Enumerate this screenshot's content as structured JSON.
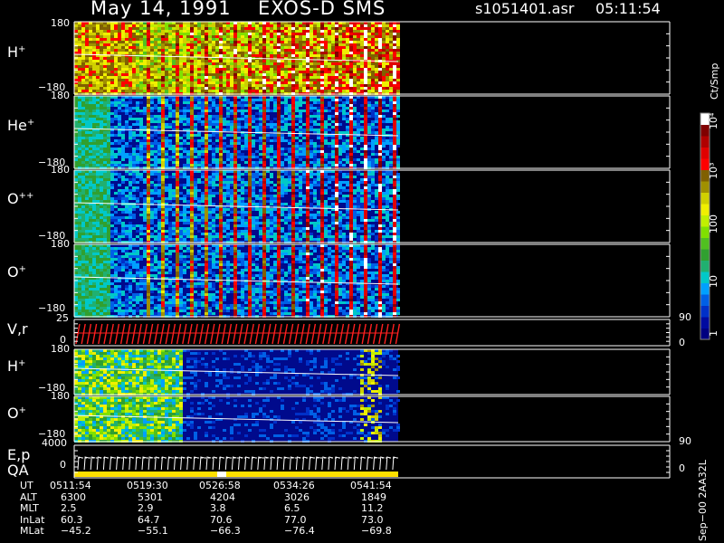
{
  "header": {
    "date": "May 14, 1991",
    "instrument": "EXOS-D SMS",
    "file": "s1051401.asr",
    "time": "05:11:54"
  },
  "colorbar": {
    "units": "Ct/Smp",
    "ticks": [
      "1",
      "10",
      "100",
      "10³",
      "10⁴"
    ],
    "colors": [
      "#000080",
      "#000aa0",
      "#0030c8",
      "#0060e6",
      "#00a0ff",
      "#00c8c8",
      "#20b070",
      "#30a030",
      "#50c020",
      "#80e000",
      "#c0f000",
      "#f0f000",
      "#d0d000",
      "#a09000",
      "#806000",
      "#ff0000",
      "#e00000",
      "#b00000",
      "#800000",
      "#ffffff"
    ]
  },
  "panels": [
    {
      "label": "H",
      "charge": "+",
      "top": "180",
      "bottom": "−180"
    },
    {
      "label": "He",
      "charge": "+",
      "top": "180",
      "bottom": "−180"
    },
    {
      "label": "O",
      "charge": "++",
      "top": "180",
      "bottom": "−180"
    },
    {
      "label": "O",
      "charge": "+",
      "top": "180",
      "bottom": "−180"
    },
    {
      "label": "V,r",
      "charge": "",
      "top": "25",
      "bottom": "0",
      "right_top": "90",
      "right_bottom": "0"
    },
    {
      "label": "H",
      "charge": "+",
      "top": "180",
      "bottom": "−180"
    },
    {
      "label": "O",
      "charge": "+",
      "top": "180",
      "bottom": "−180"
    },
    {
      "label": "E,p",
      "label2": "QA",
      "charge": "",
      "top": "4000",
      "bottom": "0",
      "right_top": "90",
      "right_bottom": "0"
    }
  ],
  "ephemeris": {
    "rows": [
      {
        "name": "UT",
        "values": [
          "0511:54",
          "0519:30",
          "0526:58",
          "0534:26",
          "0541:54"
        ]
      },
      {
        "name": "ALT",
        "values": [
          "6300",
          "5301",
          "4204",
          "3026",
          "1849"
        ]
      },
      {
        "name": "MLT",
        "values": [
          "2.5",
          "2.9",
          "3.8",
          "6.5",
          "11.2"
        ]
      },
      {
        "name": "InLat",
        "values": [
          "60.3",
          "64.7",
          "70.6",
          "77.0",
          "73.0"
        ]
      },
      {
        "name": "MLat",
        "values": [
          "−45.2",
          "−55.1",
          "−66.3",
          "−76.4",
          "−69.8"
        ]
      }
    ]
  },
  "footer_id": "Sep−00  2AA32L",
  "chart_data": {
    "type": "heatmap",
    "title": "May 14, 1991   EXOS-D SMS",
    "xlabel": "UT",
    "x": [
      "0511:54",
      "0519:30",
      "0526:58",
      "0534:26",
      "0541:54"
    ],
    "ylim": [
      -180,
      180
    ],
    "series": [
      {
        "name": "H+",
        "ylim": [
          -180,
          180
        ]
      },
      {
        "name": "He+",
        "ylim": [
          -180,
          180
        ]
      },
      {
        "name": "O++",
        "ylim": [
          -180,
          180
        ]
      },
      {
        "name": "O+",
        "ylim": [
          -180,
          180
        ]
      },
      {
        "name": "V,r",
        "ylim": [
          0,
          25
        ],
        "right_ylim": [
          0,
          90
        ]
      },
      {
        "name": "H+",
        "ylim": [
          -180,
          180
        ]
      },
      {
        "name": "O+",
        "ylim": [
          -180,
          180
        ]
      },
      {
        "name": "E,p QA",
        "ylim": [
          0,
          4000
        ],
        "right_ylim": [
          0,
          90
        ]
      }
    ],
    "colorbar_unit": "Ct/Smp",
    "color_scale": "log",
    "color_range": [
      1,
      10000
    ]
  }
}
